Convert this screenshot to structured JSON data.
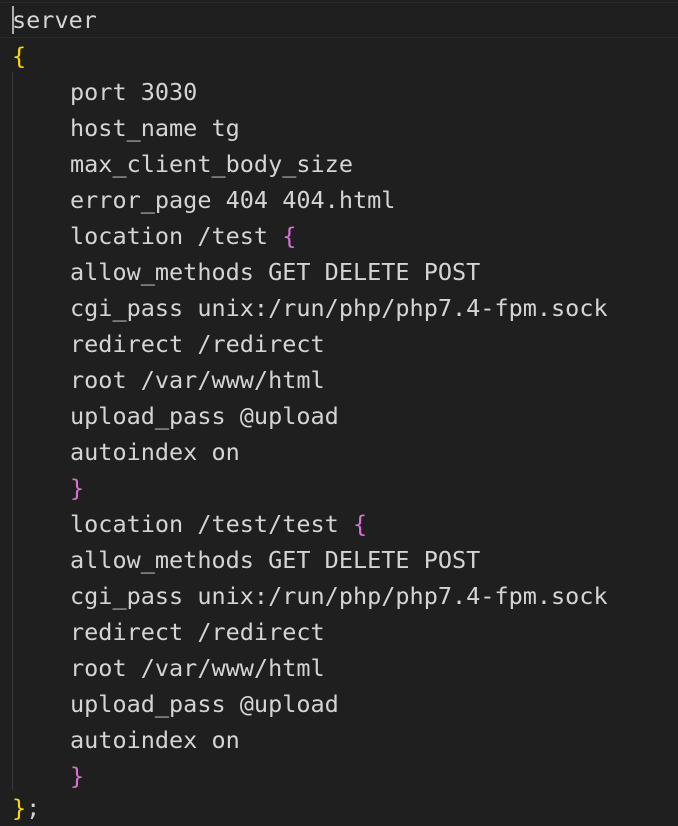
{
  "code": {
    "line_01": "server",
    "open_brace": "{",
    "line_03": "port 3030",
    "line_04": "host_name tg",
    "line_05": "max_client_body_size",
    "line_06": "error_page 404 404.html",
    "line_07_text": "location /test ",
    "line_07_brace": "{",
    "line_08": "allow_methods GET DELETE POST",
    "line_09": "cgi_pass unix:/run/php/php7.4-fpm.sock",
    "line_10": "redirect /redirect",
    "line_11": "root /var/www/html",
    "line_12": "upload_pass @upload",
    "line_13": "autoindex on",
    "line_14_brace": "}",
    "line_15_text": "location /test/test ",
    "line_15_brace": "{",
    "line_16": "allow_methods GET DELETE POST",
    "line_17": "cgi_pass unix:/run/php/php7.4-fpm.sock",
    "line_18": "redirect /redirect",
    "line_19": "root /var/www/html",
    "line_20": "upload_pass @upload",
    "line_21": "autoindex on",
    "line_22_brace": "}",
    "close_brace": "}",
    "semicolon": ";"
  },
  "colors": {
    "background": "#1f1f1f",
    "text": "#d4d4d4",
    "outer_brace": "#ffd700",
    "inner_brace": "#da70d6"
  }
}
